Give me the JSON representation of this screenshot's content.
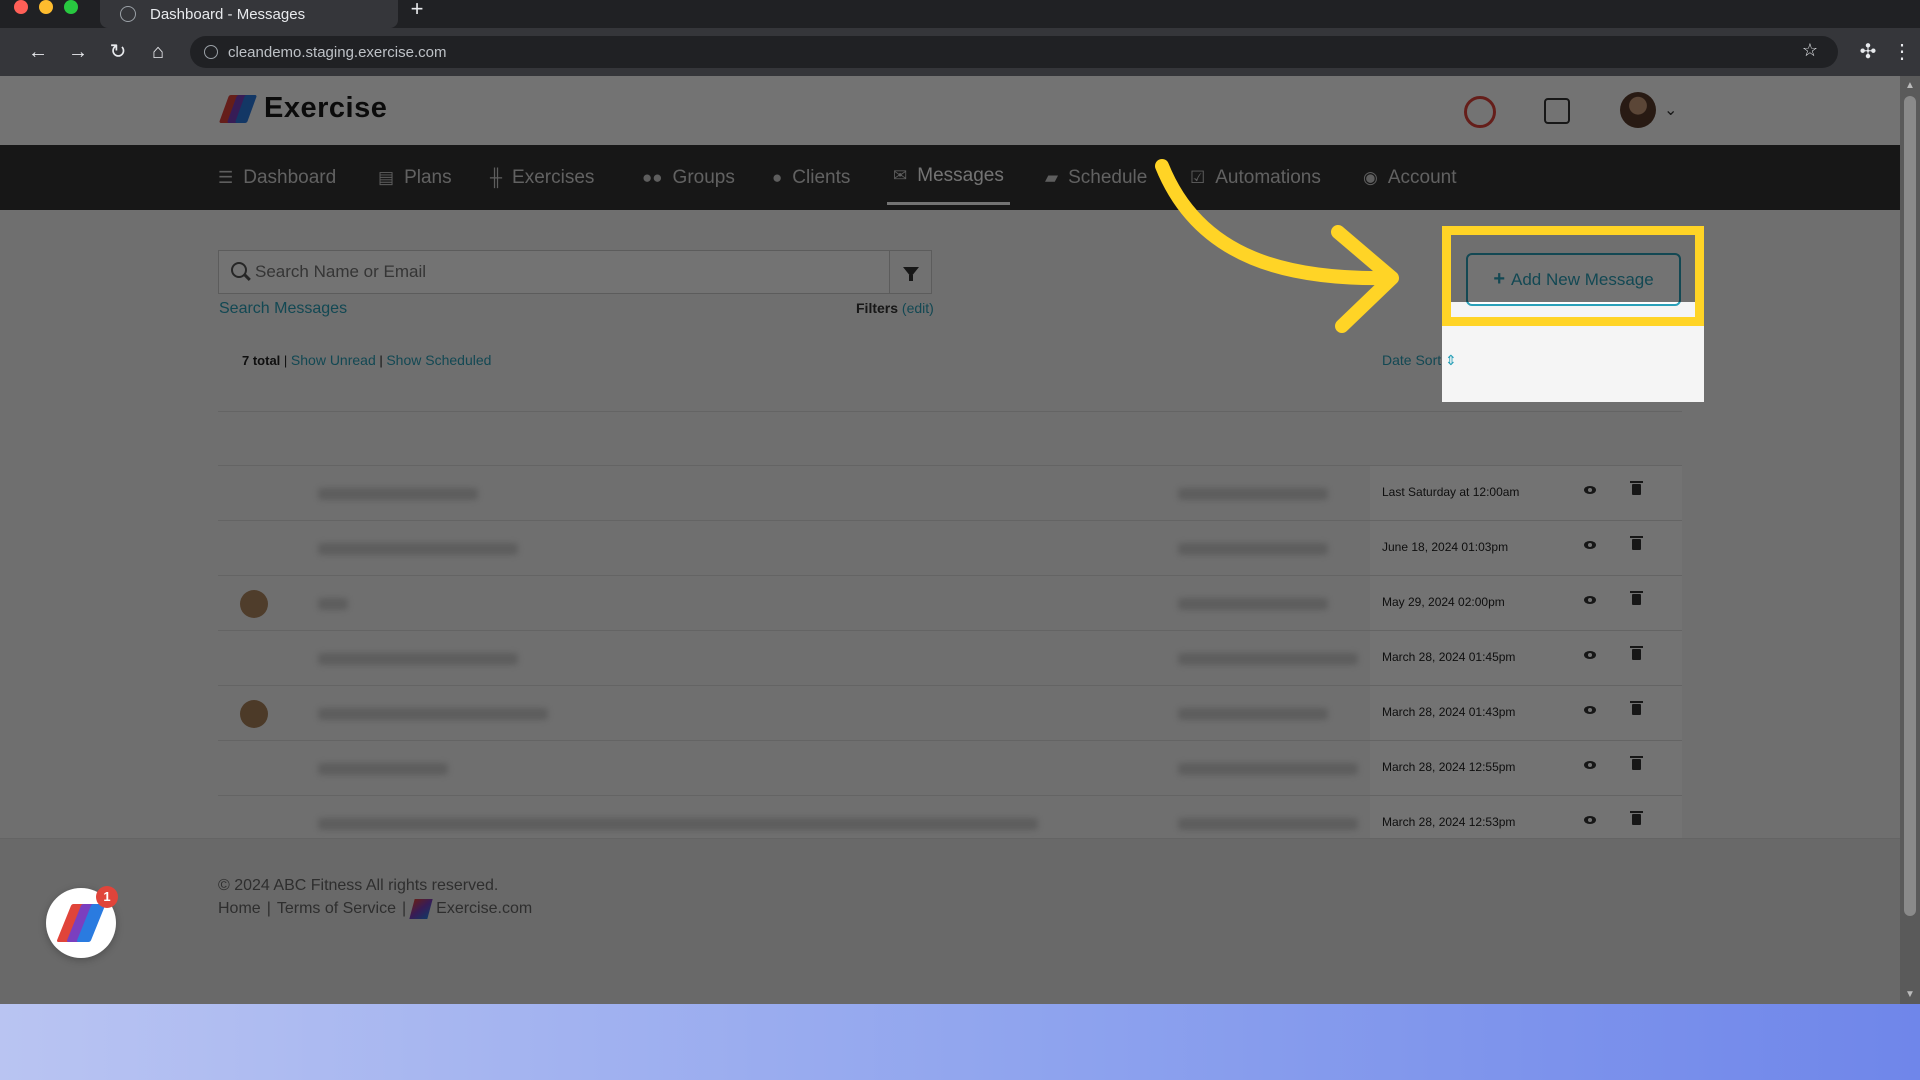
{
  "browser": {
    "tab_title": "Dashboard - Messages",
    "url": "cleandemo.staging.exercise.com"
  },
  "header": {
    "brand": "Exercise"
  },
  "nav": {
    "items": [
      {
        "label": "Dashboard",
        "icon": "list-icon"
      },
      {
        "label": "Plans",
        "icon": "clipboard-icon"
      },
      {
        "label": "Exercises",
        "icon": "dumbbell-icon"
      },
      {
        "label": "Groups",
        "icon": "users-icon"
      },
      {
        "label": "Clients",
        "icon": "user-icon"
      },
      {
        "label": "Messages",
        "icon": "envelope-icon"
      },
      {
        "label": "Schedule",
        "icon": "book-icon"
      },
      {
        "label": "Automations",
        "icon": "check-square-icon"
      },
      {
        "label": "Account",
        "icon": "user-circle-icon"
      }
    ],
    "active": "Messages"
  },
  "search": {
    "placeholder": "Search Name or Email",
    "search_link": "Search Messages",
    "filters_label": "Filters",
    "filters_edit": "(edit)"
  },
  "actions": {
    "add_new_message": "Add New Message"
  },
  "list": {
    "total": "7 total",
    "show_unread": "Show Unread",
    "show_scheduled": "Show Scheduled",
    "date_sort": "Date Sort",
    "rows": [
      {
        "date": "Last Saturday at 12:00am"
      },
      {
        "date": "June 18, 2024 01:03pm"
      },
      {
        "date": "May 29, 2024 02:00pm"
      },
      {
        "date": "March 28, 2024 01:45pm"
      },
      {
        "date": "March 28, 2024 01:43pm"
      },
      {
        "date": "March 28, 2024 12:55pm"
      },
      {
        "date": "March 28, 2024 12:53pm"
      }
    ]
  },
  "footer": {
    "copyright": "© 2024 ABC Fitness All rights reserved.",
    "home": "Home",
    "terms": "Terms of Service",
    "site": "Exercise.com"
  },
  "fab": {
    "badge": "1"
  },
  "colors": {
    "accent": "#2aa0b8",
    "highlight": "#ffd426",
    "nav_bg": "#333333",
    "alert_red": "#e0443a"
  }
}
